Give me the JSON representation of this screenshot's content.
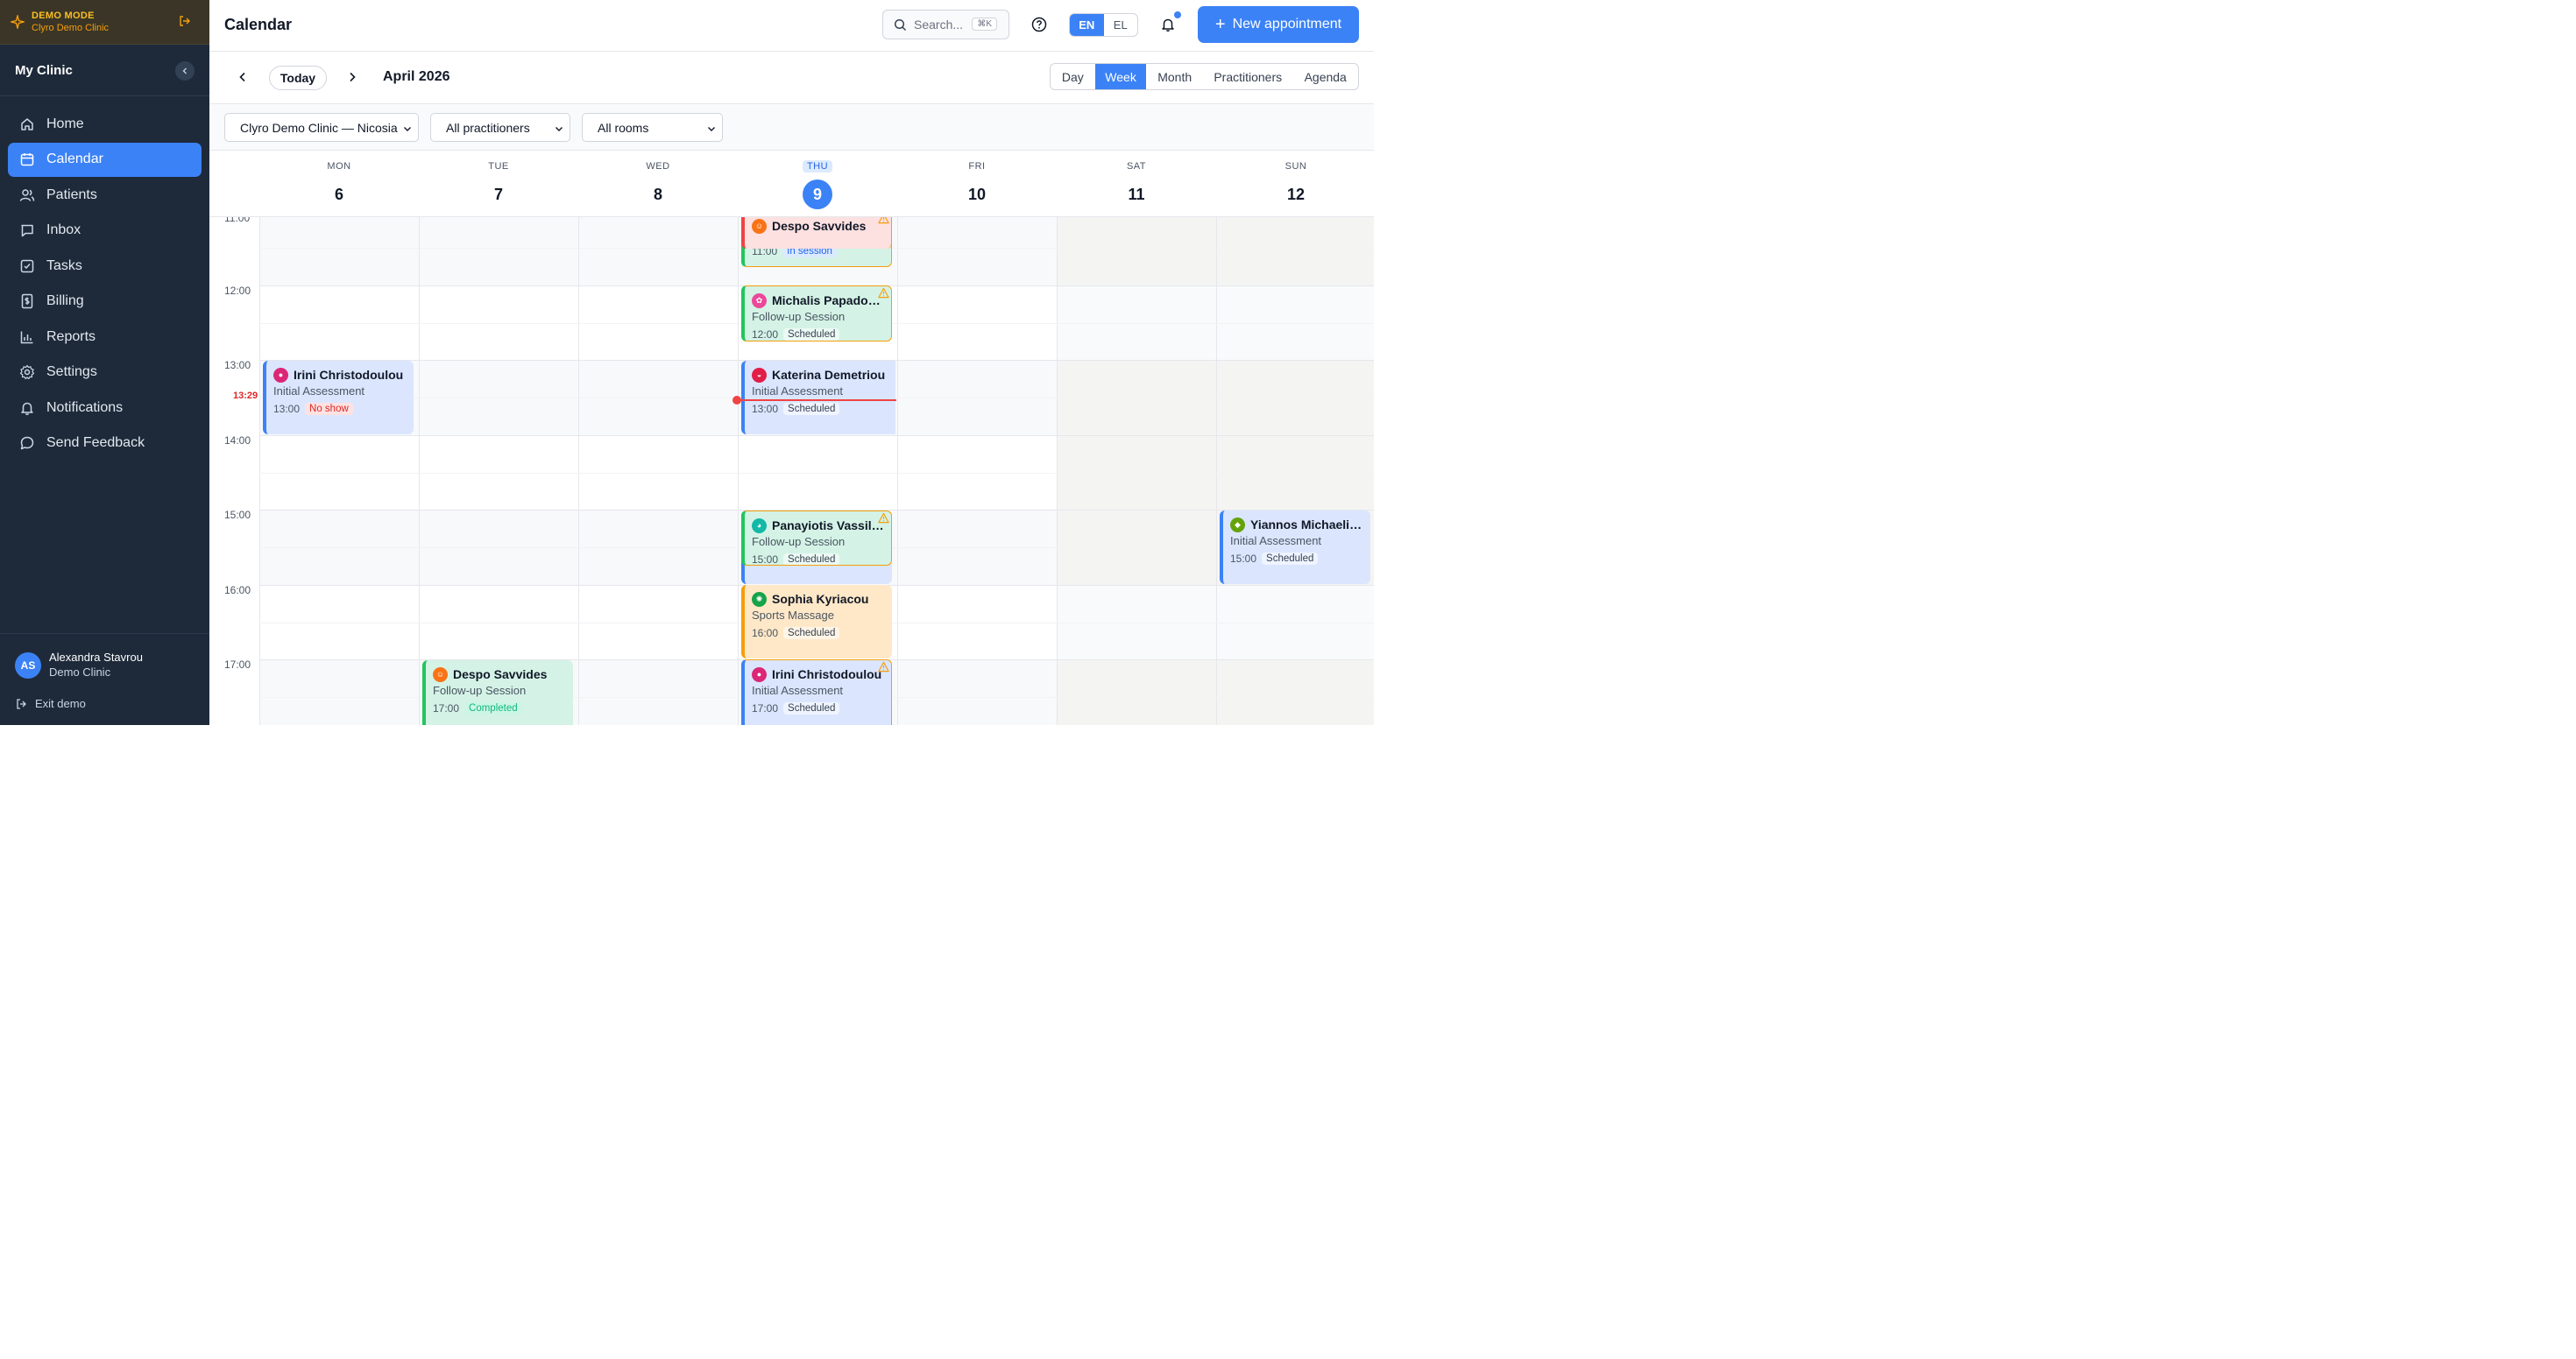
{
  "demo": {
    "title": "DEMO MODE",
    "subtitle": "Clyro Demo Clinic"
  },
  "sidebar": {
    "clinic_name": "My Clinic",
    "items": [
      {
        "label": "Home",
        "icon": "home-icon"
      },
      {
        "label": "Calendar",
        "icon": "calendar-icon",
        "active": true
      },
      {
        "label": "Patients",
        "icon": "users-icon"
      },
      {
        "label": "Inbox",
        "icon": "inbox-icon"
      },
      {
        "label": "Tasks",
        "icon": "tasks-icon"
      },
      {
        "label": "Billing",
        "icon": "billing-icon"
      },
      {
        "label": "Reports",
        "icon": "reports-icon"
      },
      {
        "label": "Settings",
        "icon": "gear-icon"
      },
      {
        "label": "Notifications",
        "icon": "bell-icon"
      },
      {
        "label": "Send Feedback",
        "icon": "feedback-icon"
      }
    ],
    "user": {
      "initials": "AS",
      "name": "Alexandra Stavrou",
      "org": "Demo Clinic"
    },
    "exit_label": "Exit demo"
  },
  "header": {
    "title": "Calendar",
    "search_placeholder": "Search...",
    "search_shortcut": "⌘K",
    "lang": {
      "active": "EN",
      "other": "EL"
    },
    "new_appointment": "New appointment"
  },
  "nav": {
    "today": "Today",
    "period": "April 2026",
    "views": [
      "Day",
      "Week",
      "Month",
      "Practitioners",
      "Agenda"
    ],
    "active_view": "Week"
  },
  "filters": {
    "location": "Clyro Demo Clinic — Nicosia",
    "practitioners": "All practitioners",
    "rooms": "All rooms"
  },
  "days": [
    {
      "name": "MON",
      "num": "6"
    },
    {
      "name": "TUE",
      "num": "7"
    },
    {
      "name": "WED",
      "num": "8"
    },
    {
      "name": "THU",
      "num": "9",
      "today": true
    },
    {
      "name": "FRI",
      "num": "10"
    },
    {
      "name": "SAT",
      "num": "11"
    },
    {
      "name": "SUN",
      "num": "12"
    }
  ],
  "times": [
    "11:00",
    "12:00",
    "13:00",
    "14:00",
    "15:00",
    "16:00",
    "17:00"
  ],
  "now_time": "13:29",
  "events": [
    {
      "patient": "Despo Savvides",
      "type": "",
      "time": "11:00",
      "status": "In session"
    },
    {
      "patient": "Michalis Papadopoulos",
      "type": "Follow-up Session",
      "time": "12:00",
      "status": "Scheduled"
    },
    {
      "patient": "Irini Christodoulou",
      "type": "Initial Assessment",
      "time": "13:00",
      "status": "No show"
    },
    {
      "patient": "Katerina Demetriou",
      "type": "Initial Assessment",
      "time": "13:00",
      "status": "Scheduled"
    },
    {
      "patient": "Panayiotis Vassiliou",
      "type": "Follow-up Session",
      "time": "15:00",
      "status": "Scheduled"
    },
    {
      "patient": "Yiannos Michaelides",
      "type": "Initial Assessment",
      "time": "15:00",
      "status": "Scheduled"
    },
    {
      "patient": "Sophia Kyriacou",
      "type": "Sports Massage",
      "time": "16:00",
      "status": "Scheduled"
    },
    {
      "patient": "Despo Savvides",
      "type": "Follow-up Session",
      "time": "17:00",
      "status": "Completed"
    },
    {
      "patient": "Irini Christodoulou",
      "type": "Initial Assessment",
      "time": "17:00",
      "status": "Scheduled"
    }
  ]
}
